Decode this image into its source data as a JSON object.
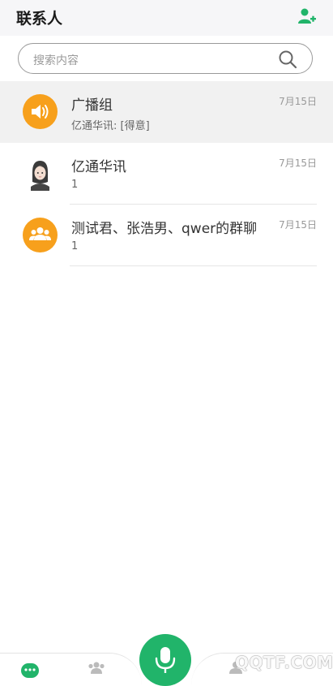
{
  "header": {
    "title": "联系人"
  },
  "search": {
    "placeholder": "搜索内容"
  },
  "conversations": [
    {
      "name": "广播组",
      "preview": "亿通华讯: [得意]",
      "date": "7月15日",
      "avatar": "speaker-icon",
      "active": true
    },
    {
      "name": "亿通华讯",
      "preview": "1",
      "date": "7月15日",
      "avatar": "user-avatar",
      "active": false
    },
    {
      "name": "测试君、张浩男、qwer的群聊",
      "preview": "1",
      "date": "7月15日",
      "avatar": "group-icon",
      "active": false
    }
  ],
  "tabbar": {
    "tabs": [
      "chat-icon",
      "group-icon",
      "mic-icon",
      "contacts-icon"
    ]
  },
  "watermark": "QQTF.COM",
  "colors": {
    "accent": "#21b46a",
    "avatar_orange": "#f7a01c",
    "active_row": "#f1f1f1",
    "header_bg": "#f6f6f8"
  }
}
